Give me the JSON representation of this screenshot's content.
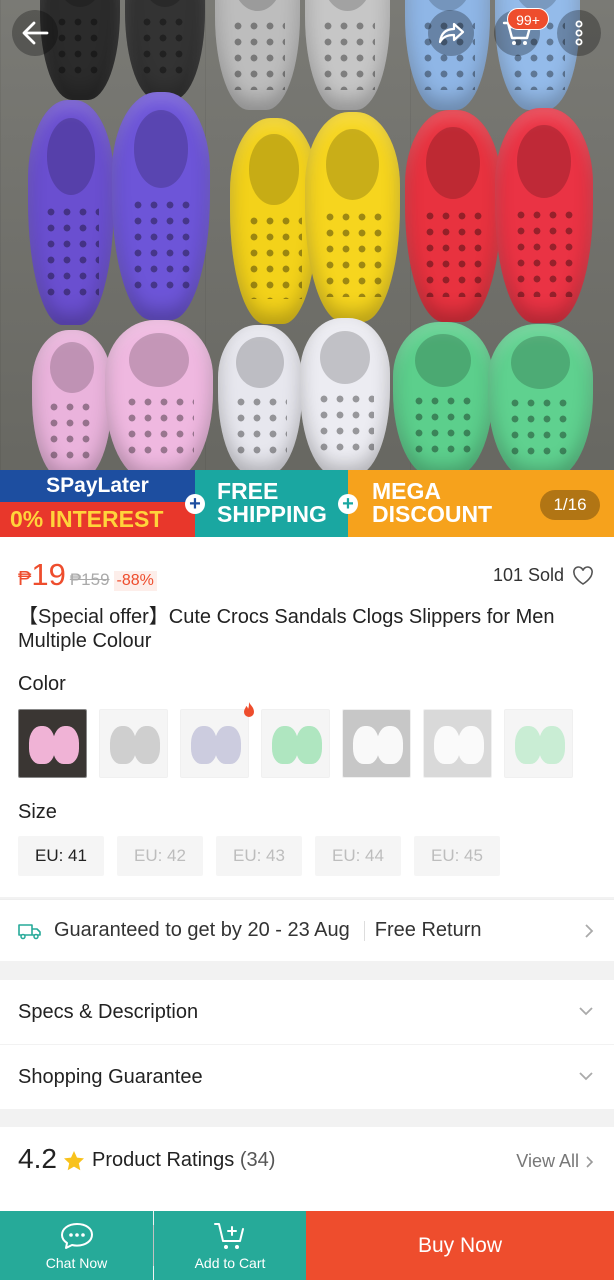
{
  "gallery": {
    "counter": "1/16",
    "cart_badge": "99+",
    "promo": {
      "spaylater": "SPayLater",
      "interest": "0% INTEREST",
      "free_line1": "FREE",
      "free_line2": "SHIPPING",
      "mega_line1": "MEGA",
      "mega_line2": "DISCOUNT"
    }
  },
  "product": {
    "currency": "₱",
    "price": "19",
    "original_price": "₱159",
    "discount": "-88%",
    "sold": "101 Sold",
    "title": "【Special offer】Cute Crocs Sandals Clogs Slippers for Men Multiple Colour"
  },
  "variations": {
    "color_label": "Color",
    "size_label": "Size",
    "colors": [
      "#f0b3d6",
      "#c9c9c9",
      "#b9b9c9",
      "#8ee0a4",
      "#f2f2f2",
      "#f4f4f4",
      "#b8e6c4"
    ],
    "sizes": [
      {
        "label": "EU: 41",
        "available": true
      },
      {
        "label": "EU: 42",
        "available": false
      },
      {
        "label": "EU: 43",
        "available": false
      },
      {
        "label": "EU: 44",
        "available": false
      },
      {
        "label": "EU: 45",
        "available": false
      }
    ]
  },
  "shipping": {
    "guarantee": "Guaranteed to get by 20 - 23 Aug",
    "free_return": "Free Return"
  },
  "sections": {
    "specs": "Specs & Description",
    "guarantee": "Shopping Guarantee"
  },
  "ratings": {
    "score": "4.2",
    "label": "Product Ratings",
    "count": "(34)",
    "view_all": "View All"
  },
  "bottom_bar": {
    "chat": "Chat Now",
    "add_to_cart": "Add to Cart",
    "buy_now": "Buy Now"
  },
  "colors": {
    "brand": "#ee4d2d",
    "teal": "#26aa99"
  }
}
